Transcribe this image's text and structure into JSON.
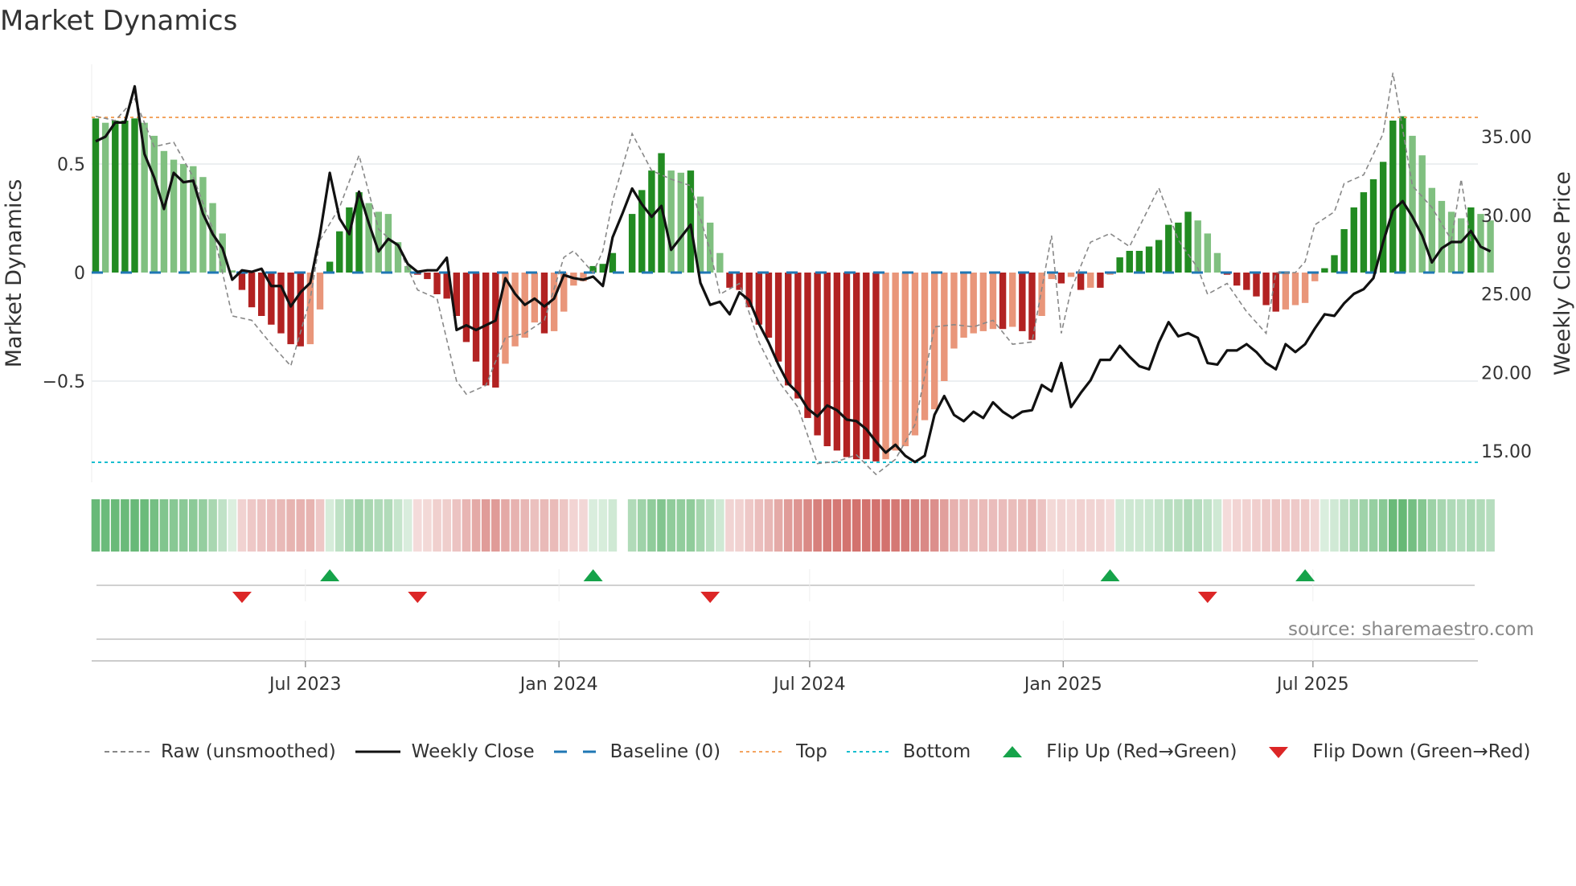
{
  "title": "Market Dynamics",
  "source": "source: sharemaestro.com",
  "legend": [
    {
      "label": "Raw (unsmoothed)",
      "icon": "dashed-grey-line"
    },
    {
      "label": "Weekly Close",
      "icon": "solid-black-line"
    },
    {
      "label": "Baseline (0)",
      "icon": "dashed-blue-line"
    },
    {
      "label": "Top",
      "icon": "dotted-orange-line"
    },
    {
      "label": "Bottom",
      "icon": "dotted-cyan-line"
    },
    {
      "label": "Flip Up (Red→Green)",
      "icon": "triangle-up-green"
    },
    {
      "label": "Flip Down (Green→Red)",
      "icon": "triangle-down-red"
    }
  ],
  "colors": {
    "dark_green": "#228b22",
    "light_green": "#80c080",
    "dark_red": "#b22222",
    "light_red": "#e9967a",
    "price": "#111111",
    "raw": "#888888",
    "baseline": "#1f77b4",
    "top": "#f4a460",
    "bottom": "#17becf",
    "flip_up": "#16a34a",
    "flip_down": "#dc2626"
  },
  "chart_data": {
    "type": "bar",
    "title": "Market Dynamics",
    "ylabel": "Market Dynamics",
    "y2label": "Weekly Close Price",
    "ylim": [
      -0.93,
      0.97
    ],
    "y2lim": [
      13.2,
      39.0
    ],
    "yticks": [
      {
        "v": 0.5,
        "label": "0.5"
      },
      {
        "v": 0,
        "label": "0"
      },
      {
        "v": -0.5,
        "label": "−0.5"
      }
    ],
    "y2ticks": [
      {
        "v": 35,
        "label": "35.00"
      },
      {
        "v": 30,
        "label": "30.00"
      },
      {
        "v": 25,
        "label": "25.00"
      },
      {
        "v": 20,
        "label": "20.00"
      },
      {
        "v": 15,
        "label": "15.00"
      }
    ],
    "xticks": [
      {
        "week": 21.5,
        "label": "Jul 2023"
      },
      {
        "week": 47.5,
        "label": "Jan 2024"
      },
      {
        "week": 73.2,
        "label": "Jul 2024"
      },
      {
        "week": 99.2,
        "label": "Jan 2025"
      },
      {
        "week": 124.8,
        "label": "Jul 2025"
      }
    ],
    "top": 0.715,
    "bottom": -0.874,
    "baseline": 0,
    "momentum": [
      0.71,
      0.69,
      0.7,
      0.7,
      0.71,
      0.69,
      0.63,
      0.56,
      0.52,
      0.5,
      0.49,
      0.44,
      0.32,
      0.18,
      0.01,
      -0.08,
      -0.16,
      -0.2,
      -0.24,
      -0.28,
      -0.33,
      -0.34,
      -0.33,
      -0.17,
      0.05,
      0.19,
      0.3,
      0.37,
      0.32,
      0.28,
      0.27,
      0.14,
      0.03,
      -0.01,
      -0.03,
      -0.1,
      -0.12,
      -0.2,
      -0.32,
      -0.41,
      -0.52,
      -0.53,
      -0.42,
      -0.34,
      -0.3,
      -0.23,
      -0.28,
      -0.27,
      -0.18,
      -0.06,
      -0.04,
      0.03,
      0.04,
      0.09,
      0.0,
      0.27,
      0.38,
      0.47,
      0.55,
      0.47,
      0.46,
      0.47,
      0.35,
      0.23,
      0.09,
      -0.07,
      -0.08,
      -0.16,
      -0.24,
      -0.3,
      -0.41,
      -0.52,
      -0.58,
      -0.67,
      -0.75,
      -0.8,
      -0.82,
      -0.85,
      -0.86,
      -0.86,
      -0.87,
      -0.86,
      -0.82,
      -0.8,
      -0.75,
      -0.68,
      -0.63,
      -0.5,
      -0.35,
      -0.3,
      -0.28,
      -0.27,
      -0.26,
      -0.26,
      -0.25,
      -0.27,
      -0.31,
      -0.2,
      -0.03,
      -0.05,
      -0.02,
      -0.08,
      -0.07,
      -0.07,
      -0.01,
      0.07,
      0.1,
      0.1,
      0.12,
      0.15,
      0.22,
      0.23,
      0.28,
      0.24,
      0.18,
      0.09,
      -0.01,
      -0.06,
      -0.08,
      -0.11,
      -0.15,
      -0.18,
      -0.17,
      -0.15,
      -0.14,
      -0.04,
      0.02,
      0.08,
      0.2,
      0.3,
      0.37,
      0.43,
      0.51,
      0.7,
      0.72,
      0.63,
      0.54,
      0.39,
      0.33,
      0.28,
      0.25,
      0.3,
      0.27,
      0.24
    ],
    "raw": [
      [
        0,
        0.72
      ],
      [
        2,
        0.7
      ],
      [
        4,
        0.8
      ],
      [
        6,
        0.58
      ],
      [
        8,
        0.6
      ],
      [
        10,
        0.44
      ],
      [
        12,
        0.2
      ],
      [
        14,
        -0.2
      ],
      [
        16,
        -0.22
      ],
      [
        18,
        -0.33
      ],
      [
        20,
        -0.43
      ],
      [
        22,
        -0.12
      ],
      [
        23,
        0.15
      ],
      [
        25,
        0.3
      ],
      [
        27,
        0.54
      ],
      [
        29,
        0.2
      ],
      [
        31,
        0.12
      ],
      [
        33,
        -0.08
      ],
      [
        35,
        -0.12
      ],
      [
        37,
        -0.5
      ],
      [
        38,
        -0.56
      ],
      [
        40,
        -0.52
      ],
      [
        42,
        -0.3
      ],
      [
        44,
        -0.28
      ],
      [
        46,
        -0.22
      ],
      [
        48,
        0.07
      ],
      [
        49,
        0.1
      ],
      [
        51,
        0.0
      ],
      [
        52,
        0.1
      ],
      [
        53,
        0.33
      ],
      [
        55,
        0.64
      ],
      [
        57,
        0.47
      ],
      [
        59,
        0.43
      ],
      [
        61,
        0.4
      ],
      [
        63,
        0.1
      ],
      [
        64,
        -0.1
      ],
      [
        66,
        -0.05
      ],
      [
        68,
        -0.32
      ],
      [
        70,
        -0.5
      ],
      [
        72,
        -0.62
      ],
      [
        74,
        -0.88
      ],
      [
        76,
        -0.87
      ],
      [
        78,
        -0.84
      ],
      [
        80,
        -0.93
      ],
      [
        82,
        -0.86
      ],
      [
        84,
        -0.7
      ],
      [
        86,
        -0.25
      ],
      [
        88,
        -0.24
      ],
      [
        90,
        -0.25
      ],
      [
        92,
        -0.22
      ],
      [
        94,
        -0.33
      ],
      [
        96,
        -0.32
      ],
      [
        98,
        0.17
      ],
      [
        99,
        -0.28
      ],
      [
        100,
        -0.08
      ],
      [
        102,
        0.14
      ],
      [
        104,
        0.18
      ],
      [
        106,
        0.12
      ],
      [
        108,
        0.3
      ],
      [
        109,
        0.39
      ],
      [
        111,
        0.15
      ],
      [
        113,
        0.02
      ],
      [
        114,
        -0.1
      ],
      [
        116,
        -0.05
      ],
      [
        118,
        -0.18
      ],
      [
        120,
        -0.28
      ],
      [
        121,
        0.0
      ],
      [
        123,
        0.0
      ],
      [
        124,
        0.05
      ],
      [
        125,
        0.22
      ],
      [
        127,
        0.28
      ],
      [
        128,
        0.41
      ],
      [
        130,
        0.45
      ],
      [
        132,
        0.64
      ],
      [
        133,
        0.92
      ],
      [
        135,
        0.4
      ],
      [
        137,
        0.3
      ],
      [
        139,
        0.15
      ],
      [
        140,
        0.43
      ],
      [
        141,
        0.14
      ]
    ],
    "price": [
      34.7,
      35.0,
      35.9,
      35.9,
      38.2,
      33.9,
      32.4,
      30.4,
      32.7,
      32.1,
      32.2,
      30.1,
      28.8,
      27.9,
      25.9,
      26.5,
      26.4,
      26.6,
      25.5,
      25.5,
      24.2,
      25.1,
      25.7,
      28.8,
      32.7,
      29.8,
      28.8,
      31.5,
      29.5,
      27.7,
      28.5,
      28.1,
      26.9,
      26.4,
      26.5,
      26.5,
      27.3,
      22.7,
      23.0,
      22.7,
      23.0,
      23.3,
      26.0,
      25.0,
      24.3,
      24.7,
      24.2,
      24.7,
      26.2,
      26.0,
      25.9,
      26.1,
      25.5,
      28.6,
      30.1,
      31.7,
      30.7,
      29.9,
      30.6,
      27.8,
      28.6,
      29.4,
      25.7,
      24.3,
      24.5,
      23.7,
      25.1,
      24.6,
      23.1,
      21.9,
      20.5,
      19.3,
      18.7,
      17.7,
      17.2,
      17.9,
      17.6,
      17.0,
      16.9,
      16.4,
      15.6,
      14.9,
      15.4,
      14.7,
      14.3,
      14.7,
      17.3,
      18.5,
      17.3,
      16.9,
      17.5,
      17.1,
      18.1,
      17.5,
      17.1,
      17.5,
      17.6,
      19.2,
      18.8,
      20.6,
      17.8,
      18.7,
      19.5,
      20.8,
      20.8,
      21.7,
      21.0,
      20.4,
      20.2,
      21.9,
      23.2,
      22.3,
      22.5,
      22.2,
      20.6,
      20.5,
      21.4,
      21.4,
      21.8,
      21.3,
      20.6,
      20.2,
      21.8,
      21.3,
      21.8,
      22.8,
      23.7,
      23.6,
      24.4,
      25.0,
      25.3,
      26.0,
      28.3,
      30.3,
      30.9,
      29.9,
      28.7,
      27.0,
      27.9,
      28.3,
      28.3,
      29.0,
      28.0,
      27.7
    ],
    "flips_up_weeks": [
      24,
      51,
      104,
      124
    ],
    "flips_down_weeks": [
      15,
      33,
      63,
      114
    ]
  }
}
